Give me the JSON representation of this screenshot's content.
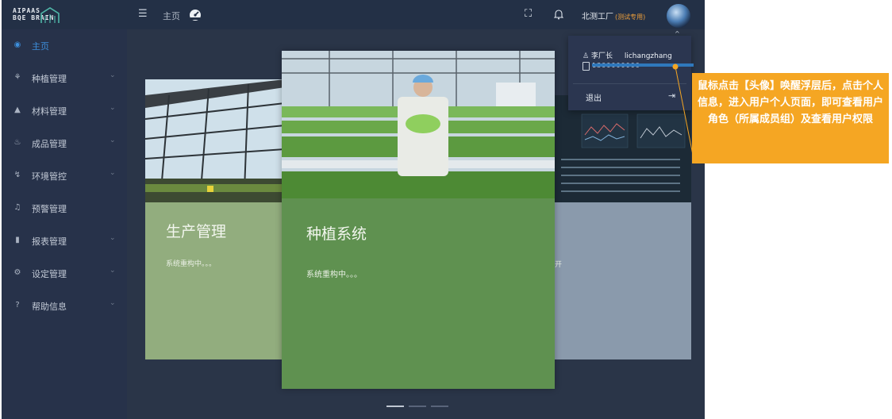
{
  "brand": {
    "line1": "AIPAAS",
    "line2": "BQE BRAIN"
  },
  "header": {
    "breadcrumb": "主页",
    "company": "北测工厂",
    "company_tag": "(测试专用)"
  },
  "sidebar": {
    "items": [
      {
        "label": "主页",
        "icon": "dashboard-icon",
        "active": true
      },
      {
        "label": "种植管理",
        "icon": "sprout-icon"
      },
      {
        "label": "材料管理",
        "icon": "material-icon"
      },
      {
        "label": "成品管理",
        "icon": "product-icon"
      },
      {
        "label": "环境管控",
        "icon": "environment-icon"
      },
      {
        "label": "预警管理",
        "icon": "bell-icon"
      },
      {
        "label": "报表管理",
        "icon": "bar-chart-icon"
      },
      {
        "label": "设定管理",
        "icon": "gear-icon"
      },
      {
        "label": "帮助信息",
        "icon": "help-icon"
      }
    ]
  },
  "cards": {
    "left": {
      "title": "生产管理",
      "subtitle": "系统重构中。。。"
    },
    "mid": {
      "title": "种植系统",
      "subtitle": "系统重构中。。。"
    },
    "right": {
      "subtitle_fragment": "开"
    }
  },
  "user_menu": {
    "name": "李厂长",
    "login": "lichangzhang",
    "phone": "1300000000",
    "logout": "退出"
  },
  "annotation": {
    "text": "鼠标点击【头像】唤醒浮层后，点击个人信息，进入用户个人页面，即可查看用户角色（所属成员组）及查看用户权限"
  },
  "colors": {
    "accent": "#3d8fdc",
    "annotation": "#f5a623",
    "card_mid": "#5f9150",
    "card_left": "#92ad7e"
  }
}
